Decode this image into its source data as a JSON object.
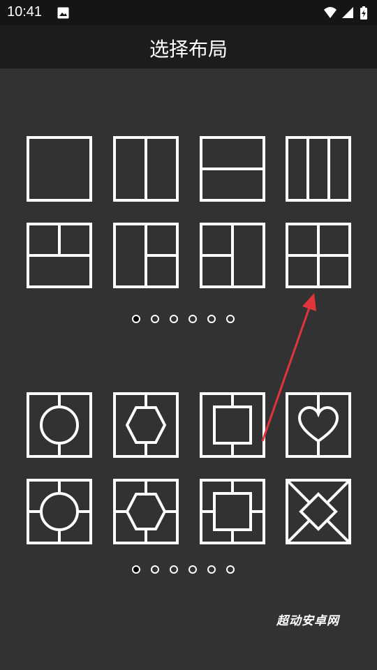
{
  "status_bar": {
    "time": "10:41"
  },
  "app_bar": {
    "title": "选择布局"
  },
  "rectangular_layouts": {
    "items": [
      "single",
      "two-columns",
      "two-rows",
      "three-columns",
      "top-two-bottom-one",
      "left-one-right-two",
      "left-two-right-one",
      "grid-2x2"
    ],
    "page_count": 6,
    "active_page": 0
  },
  "shape_layouts": {
    "items": [
      "circle-center",
      "hexagon-center",
      "square-center",
      "heart-center",
      "circle-cross",
      "hexagon-cross",
      "square-cross",
      "diamond-cross"
    ],
    "page_count": 6,
    "active_page": 0
  },
  "colors": {
    "background": "#323232",
    "app_bar": "#1c1c1c",
    "status_bar": "#151515",
    "tile_stroke": "#ffffff",
    "annotation_arrow": "#e0353b"
  },
  "watermark": "超动安卓网"
}
